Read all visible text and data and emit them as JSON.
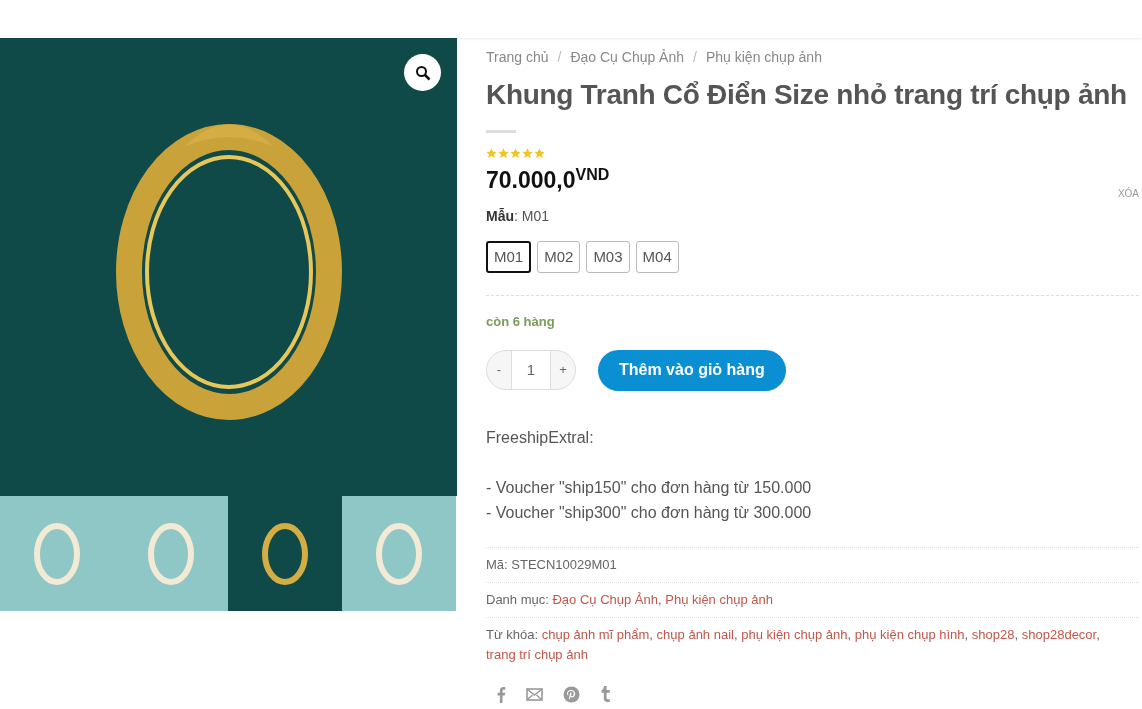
{
  "gallery": {
    "thumbnails": [
      {
        "selected": false
      },
      {
        "selected": false
      },
      {
        "selected": true
      },
      {
        "selected": false
      }
    ]
  },
  "breadcrumb": [
    "Trang chủ",
    "Đạo Cụ Chụp Ảnh",
    "Phụ kiện chụp ảnh"
  ],
  "breadcrumb_separator": "/",
  "title": "Khung Tranh Cổ Điển Size nhỏ trang trí chụp ảnh",
  "rating": {
    "stars": 5
  },
  "price": {
    "amount": "70.000,0",
    "currency": "VND"
  },
  "clear_link": "XÓA",
  "variant": {
    "label": "Mẫu",
    "label_separator": ":",
    "value": "M01",
    "options": [
      {
        "label": "M01",
        "selected": true
      },
      {
        "label": "M02",
        "selected": false
      },
      {
        "label": "M03",
        "selected": false
      },
      {
        "label": "M04",
        "selected": false
      }
    ]
  },
  "stock": "còn 6 hàng",
  "quantity": {
    "minus": "-",
    "value": "1",
    "plus": "+"
  },
  "add_to_cart": "Thêm vào giỏ hàng",
  "description": [
    "FreeshipExtral:",
    "- Voucher \"ship150\" cho đơn hàng từ 150.000",
    "- Voucher \"ship300\" cho đơn hàng từ 300.000"
  ],
  "meta": [
    {
      "kind": "text",
      "label": "Mã:",
      "value": "STECN10029M01"
    },
    {
      "kind": "links",
      "label": "Danh mục:",
      "links": [
        "Đạo Cụ Chụp Ảnh",
        "Phụ kiện chụp ảnh"
      ]
    },
    {
      "kind": "links",
      "label": "Từ khóa:",
      "links": [
        "chụp ảnh mĩ phẩm",
        "chụp ảnh nail",
        "phụ kiện chụp ảnh",
        "phụ kiện chụp hình",
        "shop28",
        "shop28decor",
        "trang trí chụp ảnh"
      ]
    }
  ],
  "list_separator": ","
}
